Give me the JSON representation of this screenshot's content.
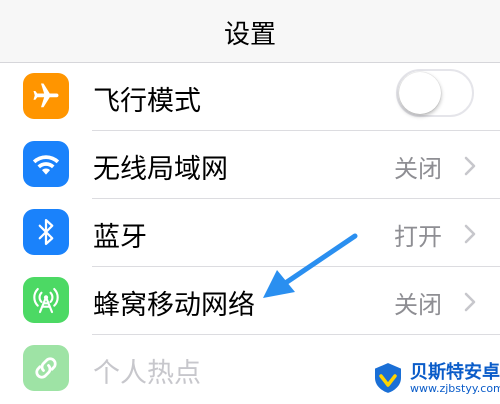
{
  "navbar": {
    "title": "设置"
  },
  "settings": {
    "airplane": {
      "label": "飞行模式",
      "icon": "airplane-icon",
      "color": "#ff9500",
      "toggle_on": false
    },
    "wifi": {
      "label": "无线局域网",
      "value": "关闭",
      "icon": "wifi-icon",
      "color": "#1a82fb"
    },
    "bluetooth": {
      "label": "蓝牙",
      "value": "打开",
      "icon": "bluetooth-icon",
      "color": "#1a82fb"
    },
    "cellular": {
      "label": "蜂窝移动网络",
      "value": "关闭",
      "icon": "cellular-antenna-icon",
      "color": "#4cd964"
    },
    "hotspot": {
      "label": "个人热点",
      "icon": "hotspot-link-icon",
      "color": "#9ee3a5",
      "disabled": true
    }
  },
  "annotation": {
    "arrow_color": "#2a8ff0"
  },
  "watermark": {
    "name": "贝斯特安卓网",
    "url": "www.zjbstyy.com"
  }
}
